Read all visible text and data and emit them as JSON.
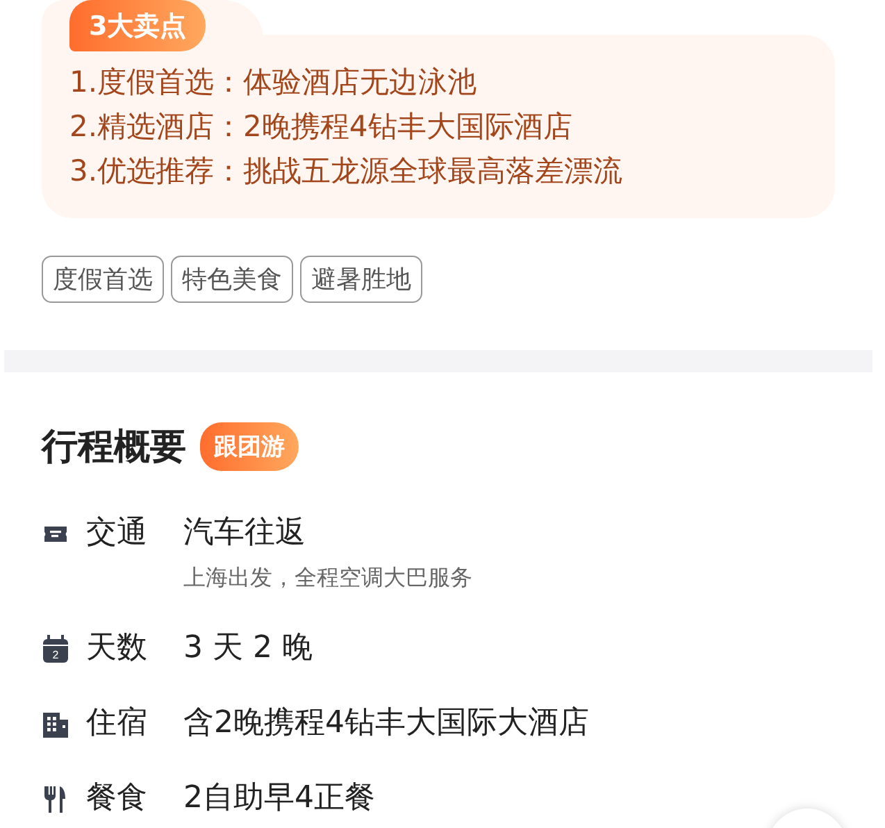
{
  "highlights": {
    "badge": "3大卖点",
    "points": [
      "1.度假首选：体验酒店无边泳池",
      "2.精选酒店：2晚携程4钻丰大国际酒店",
      "3.优选推荐：挑战五龙源全球最高落差漂流"
    ]
  },
  "tags": [
    "度假首选",
    "特色美食",
    "避暑胜地"
  ],
  "overview": {
    "title": "行程概要",
    "badge": "跟团游",
    "items": [
      {
        "kind": "transport",
        "label": "交通",
        "value": "汽车往返",
        "note": "上海出发，全程空调大巴服务"
      },
      {
        "kind": "days",
        "label": "天数",
        "value": "3 天 2 晚",
        "icon_text": "2"
      },
      {
        "kind": "hotel",
        "label": "住宿",
        "value": "含2晚携程4钻丰大国际大酒店"
      },
      {
        "kind": "meal",
        "label": "餐食",
        "value": "2自助早4正餐"
      }
    ]
  }
}
